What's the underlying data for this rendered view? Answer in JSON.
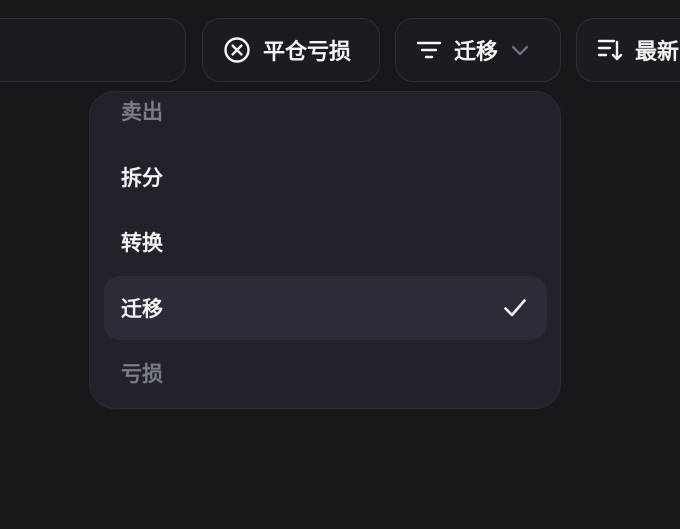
{
  "toolbar": {
    "close_loss_label": "平仓亏损",
    "filter_label": "迁移",
    "sort_label": "最新"
  },
  "menu": {
    "items": [
      {
        "label": "卖出",
        "state": "dimmed"
      },
      {
        "label": "拆分",
        "state": "normal"
      },
      {
        "label": "转换",
        "state": "normal"
      },
      {
        "label": "迁移",
        "state": "selected"
      },
      {
        "label": "亏损",
        "state": "dimmed"
      }
    ]
  },
  "colors": {
    "background": "#16181c",
    "pill_background": "#1a1c21",
    "pill_border": "#2d3037",
    "menu_background": "#20232a",
    "selected_background": "#2a2d35",
    "text": "#f1f2f4",
    "dim_text": "#7a7d85",
    "chevron": "#6b7079"
  },
  "icons": {
    "close_loss": "circle-x-icon",
    "filter": "filter-lines-icon",
    "filter_dropdown": "chevron-down-icon",
    "sort": "sort-descending-icon",
    "selected_mark": "check-icon"
  }
}
